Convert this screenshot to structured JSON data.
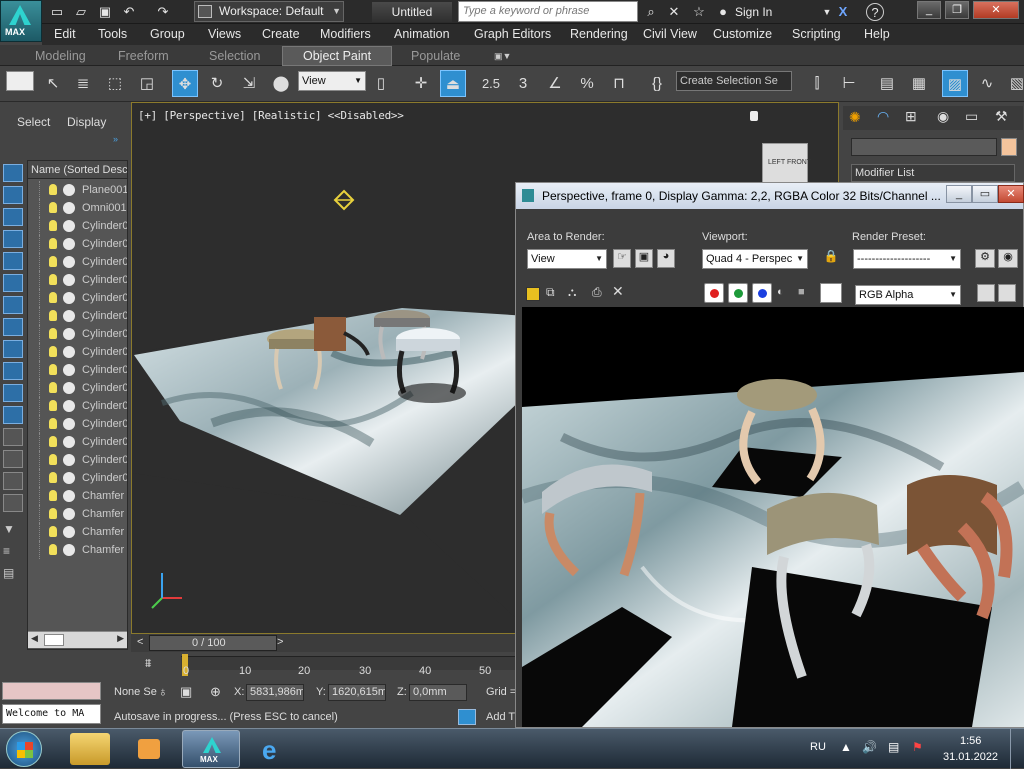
{
  "window": {
    "workspace": "Workspace: Default",
    "doc_title": "Untitled",
    "search_placeholder": "Type a keyword or phrase",
    "signin": "Sign In",
    "app_logo_text": "MAX"
  },
  "menu": [
    "Edit",
    "Tools",
    "Group",
    "Views",
    "Create",
    "Modifiers",
    "Animation",
    "Graph Editors",
    "Rendering",
    "Civil View",
    "Customize",
    "Scripting",
    "Help"
  ],
  "ribbon_tabs": [
    "Modeling",
    "Freeform",
    "Selection",
    "Object Paint",
    "Populate"
  ],
  "toolbar": {
    "ref_coord": "View",
    "selection_set": "Create Selection Se",
    "snap_25": "2.5",
    "snap_3": "3",
    "snap_pct": "%"
  },
  "left_panel": {
    "tabs": [
      "Select",
      "Display"
    ],
    "column_header": "Name (Sorted Desce",
    "objects": [
      "Plane001",
      "Omni001",
      "Cylinder0",
      "Cylinder0",
      "Cylinder0",
      "Cylinder0",
      "Cylinder0",
      "Cylinder0",
      "Cylinder0",
      "Cylinder0",
      "Cylinder0",
      "Cylinder0",
      "Cylinder0",
      "Cylinder0",
      "Cylinder0",
      "Cylinder0",
      "Cylinder0",
      "Chamfer",
      "Chamfer",
      "Chamfer",
      "Chamfer"
    ]
  },
  "viewport": {
    "label": "[+] [Perspective] [Realistic]  <<Disabled>>",
    "viewcube_left": "LEFT",
    "viewcube_front": "FRONT"
  },
  "command_panel": {
    "modifier_list": "Modifier List"
  },
  "timeline": {
    "frame_counter": "0 / 100",
    "ticks": [
      "0",
      "10",
      "20",
      "30",
      "40",
      "50"
    ]
  },
  "status": {
    "selection": "None Se",
    "x_label": "X:",
    "x_value": "5831,986m",
    "y_label": "Y:",
    "y_value": "1620,615m",
    "z_label": "Z:",
    "z_value": "0,0mm",
    "grid": "Grid =",
    "maxscript": "Welcome to MA",
    "prompt": "Autosave in progress... (Press ESC to cancel)",
    "add_time": "Add T"
  },
  "render_window": {
    "title": "Perspective, frame 0, Display Gamma: 2,2, RGBA Color 32 Bits/Channel ...",
    "area_label": "Area to Render:",
    "area_value": "View",
    "viewport_label": "Viewport:",
    "viewport_value": "Quad 4 - Perspec",
    "preset_label": "Render Preset:",
    "preset_value": "--------------------",
    "channel_value": "RGB Alpha"
  },
  "taskbar": {
    "lang": "RU",
    "time": "1:56",
    "date": "31.01.2022",
    "max_label": "MAX"
  },
  "colors": {
    "accent_blue": "#2f8fd0",
    "viewport_border": "#8b7a2c",
    "swatch": "#f4c49c"
  }
}
